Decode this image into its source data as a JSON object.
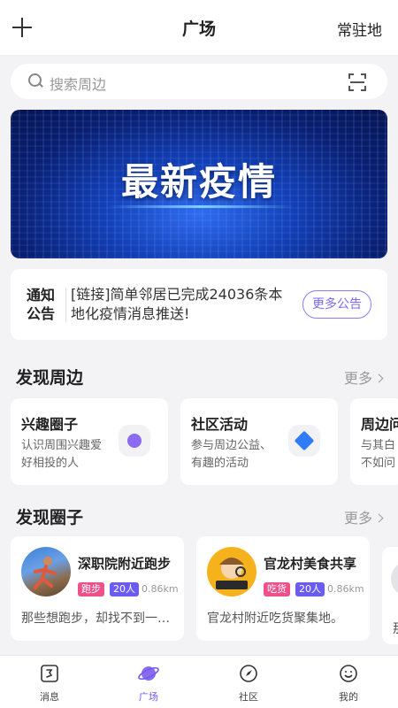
{
  "header": {
    "title": "广场",
    "right_label": "常驻地"
  },
  "search": {
    "placeholder": "搜索周边"
  },
  "banner": {
    "text": "最新疫情"
  },
  "notice": {
    "tag": "通知公告",
    "text": "[链接]简单邻居已完成24036条本地化疫情消息推送!",
    "more_label": "更多公告"
  },
  "discover_nearby": {
    "title": "发现周边",
    "more_label": "更多",
    "cards": [
      {
        "title": "兴趣圈子",
        "desc": "认识周围兴趣爱好相投的人",
        "icon": "planet-icon",
        "icon_color": "#8b6cf0"
      },
      {
        "title": "社区活动",
        "desc": "参与周边公益、有趣的活动",
        "icon": "star-icon",
        "icon_color": "#2f7cf6"
      },
      {
        "title": "周边问",
        "desc": "与其白不如问"
      }
    ]
  },
  "discover_circles": {
    "title": "发现圈子",
    "more_label": "更多",
    "cards": [
      {
        "name": "深职院附近跑步",
        "tag": "跑步",
        "tag_color": "#f0508a",
        "members": "20人",
        "distance": "0.86km",
        "desc": "那些想跑步，却找不到一…"
      },
      {
        "name": "官龙村美食共享",
        "tag": "吃货",
        "tag_color": "#f0508a",
        "members": "20人",
        "distance": "0.86km",
        "desc": "官龙村附近吃货聚集地。"
      },
      {
        "desc": "那"
      }
    ]
  },
  "tabbar": {
    "items": [
      {
        "label": "消息",
        "icon": "message-icon"
      },
      {
        "label": "广场",
        "icon": "planet-icon",
        "active": true
      },
      {
        "label": "社区",
        "icon": "compass-icon"
      },
      {
        "label": "我的",
        "icon": "smile-icon"
      }
    ],
    "active_color": "#6a5cf2"
  }
}
